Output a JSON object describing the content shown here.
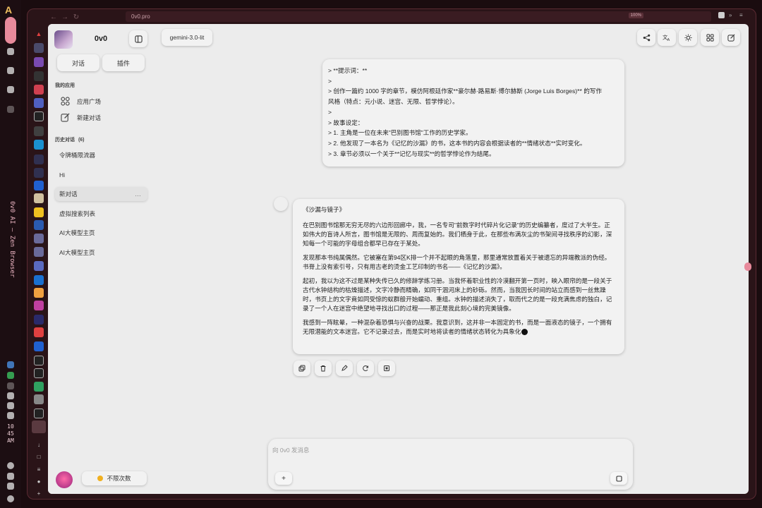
{
  "os": {
    "vertical_title": "0v0 AI – Zen Browser",
    "clock": [
      "10",
      "45",
      "AM"
    ]
  },
  "browser": {
    "url": "0v0.pro",
    "zoom": "100%"
  },
  "sidebar": {
    "app_title": "0v0",
    "tabs": [
      "对话",
      "插件"
    ],
    "my_apps_label": "我的应用",
    "apps": [
      "应用广场",
      "新建对话"
    ],
    "history_label": "历史对话",
    "history_count": "(6)",
    "history": [
      "令牌桶限流器",
      "Hi",
      "新对话",
      "虚拟搜索列表",
      "AI大模型主页",
      "AI大模型主页"
    ],
    "quota": "不限次数"
  },
  "header": {
    "model": "gemini-3.0-lit"
  },
  "user_message": {
    "lines": [
      "> **提示词：**",
      ">",
      "> 创作一篇约 1000 字的章节，模仿阿根廷作家**豪尔赫·路易斯·博尔赫斯 (Jorge Luis Borges)** 的写作",
      "风格（特点：元小说、迷宫、无限、哲学悖论）。",
      ">",
      "> 故事设定：",
      "> 1. 主角是一位在未来\"巴别图书馆\"工作的历史学家。",
      "> 2. 他发现了一本名为《记忆的沙漏》的书，这本书的内容会根据读者的**情绪状态**实时变化。",
      "> 3. 章节必须以一个关于**记忆与现实**的哲学悖论作为结尾。"
    ]
  },
  "assistant_message": {
    "title": "《沙漏与镜子》",
    "paragraphs": [
      "在巴别图书馆那无穷无尽的六边形回廊中，我，一名专司\"前数字时代碎片化记录\"的历史编纂者，度过了大半生。正如伟大的盲诗人所言，图书馆是无限的、周而复始的。我们栖身于此，在那些布满灰尘的书架间寻找秩序的幻影，深知每一个可能的字母组合都早已存在于某处。",
      "发现那本书纯属偶然。它被塞在第94区K排一个并不起眼的角落里，那里通常放置着关于被遗忘的异端教派的伪经。书脊上没有索引号，只有用古老的烫金工艺印制的书名——《记忆的沙漏》。",
      "起初，我以为这不过是某种失传已久的修辞学练习册。当我怀着职业性的冷漠翻开第一页时，映入眼帘的是一段关于古代水钟结构的枯燥描述，文字冷静而精确，如同干涸河床上的砂砾。然而，当我因长时间的站立而感到一丝焦躁时，书页上的文字竟如同受惊的蚁群般开始蠕动、重组。水钟的描述消失了，取而代之的是一段充满焦虑的独白，记录了一个人在迷宫中绝望地寻找出口的过程——那正是我此刻心境的完美镜像。",
      "我感到一阵眩晕，一种混杂着恐惧与兴奋的战栗。我意识到，这并非一本固定的书，而是一面液态的镜子，一个拥有无限潜能的文本迷宫。它不记录过去，而是实时地将读者的情绪状态转化为具象化"
    ]
  },
  "composer": {
    "placeholder": "向 0v0 发消息"
  },
  "colors": {
    "accent_pink": "#e88a9b",
    "app_bg": "#ececec",
    "frame_bg": "#2a1418"
  }
}
